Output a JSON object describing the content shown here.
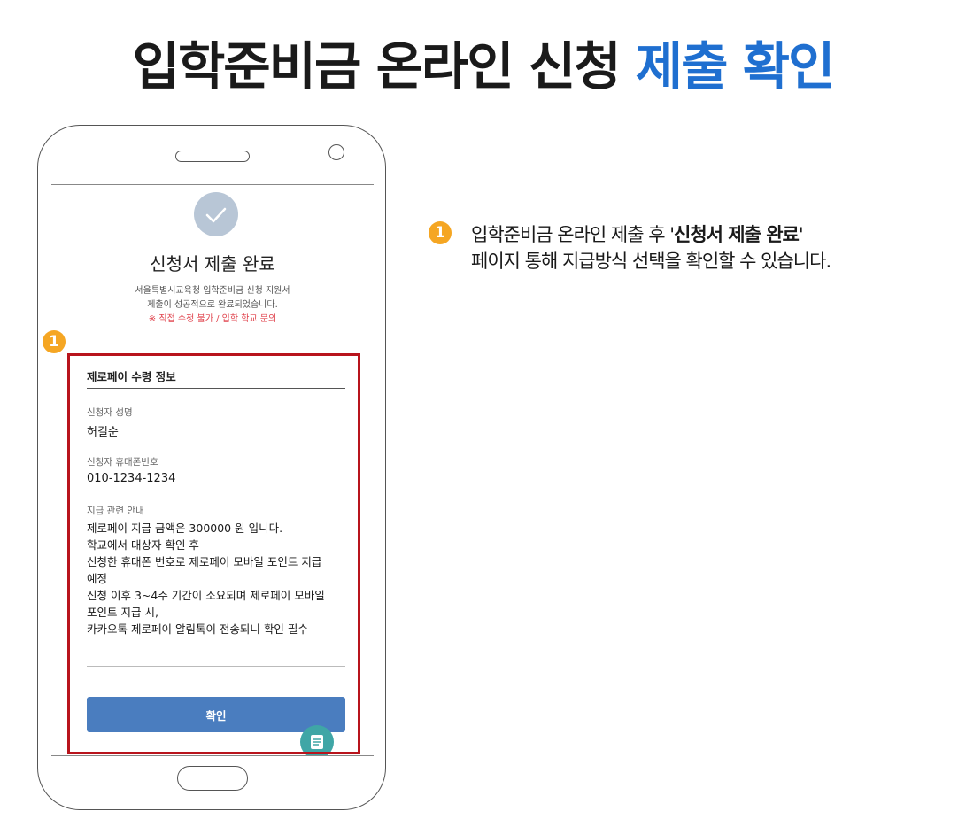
{
  "headline": {
    "main": "입학준비금 온라인 신청",
    "accent": "제출 확인"
  },
  "screen": {
    "title": "신청서 제출 완료",
    "desc_line1": "서울특별시교육청 입학준비금 신청 지원서",
    "desc_line2": "제출이 성공적으로 완료되었습니다.",
    "warning": "※ 직접 수정 불가 / 입학 학교 문의",
    "section_title": "제로페이 수령 정보",
    "name_label": "신청자 성명",
    "name_value": "허길순",
    "phone_label": "신청자 휴대폰번호",
    "phone_value": "010-1234-1234",
    "notice_label": "지급 관련 안내",
    "notice_lines": [
      "제로페이 지급 금액은 300000 원 입니다.",
      "학교에서 대상자 확인 후",
      "신청한 휴대폰 번호로 제로페이 모바일 포인트 지급",
      "예정",
      "신청 이후 3~4주 기간이 소요되며 제로페이 모바일",
      "포인트 지급 시,",
      "카카오톡 제로페이 알림톡이 전송되니 확인 필수"
    ],
    "confirm_button": "확인"
  },
  "callout": {
    "number": "1",
    "line1_prefix": "입학준비금 온라인 제출 후 '",
    "line1_bold": "신청서 제출 완료",
    "line1_suffix": "'",
    "line2": "페이지 통해 지급방식 선택을 확인할 수 있습니다."
  },
  "colors": {
    "accent": "#1f6fd0",
    "highlight_border": "#b8141c",
    "badge": "#f5a623",
    "button": "#4a7dbf",
    "warning": "#e0434d"
  },
  "icons": [
    "check-icon",
    "document-icon"
  ]
}
